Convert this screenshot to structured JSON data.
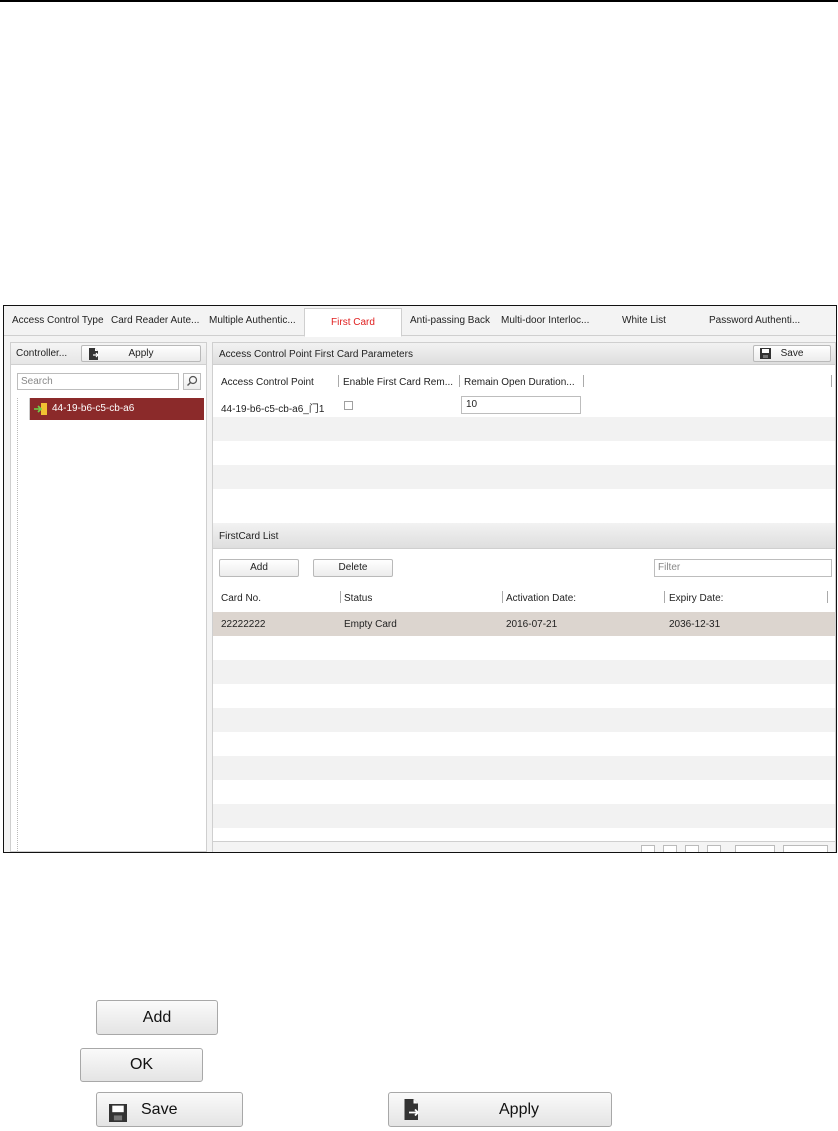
{
  "tabs": [
    {
      "label": "Access Control Type"
    },
    {
      "label": "Card Reader Aute..."
    },
    {
      "label": "Multiple Authentic..."
    },
    {
      "label": "First Card"
    },
    {
      "label": "Anti-passing Back"
    },
    {
      "label": "Multi-door Interloc..."
    },
    {
      "label": "White List"
    },
    {
      "label": "Password Authenti..."
    }
  ],
  "active_tab": "First Card",
  "left_panel": {
    "header_label": "Controller...",
    "apply_label": "Apply",
    "search_placeholder": "Search",
    "tree_item": "44-19-b6-c5-cb-a6"
  },
  "params_section": {
    "title": "Access Control Point First Card Parameters",
    "save_label": "Save",
    "columns": [
      "Access Control Point",
      "Enable First Card Rem...",
      "Remain Open Duration..."
    ],
    "row": {
      "point": "44-19-b6-c5-cb-a6_门1",
      "enabled": false,
      "duration": "10"
    }
  },
  "firstcard_list": {
    "title": "FirstCard List",
    "add_label": "Add",
    "delete_label": "Delete",
    "filter_placeholder": "Filter",
    "columns": [
      "Card No.",
      "Status",
      "Activation Date:",
      "Expiry Date:"
    ],
    "rows": [
      {
        "card_no": "22222222",
        "status": "Empty Card",
        "activation": "2016-07-21",
        "expiry": "2036-12-31"
      }
    ]
  },
  "standalone_buttons": {
    "add": "Add",
    "ok": "OK",
    "save": "Save",
    "apply": "Apply"
  },
  "colors": {
    "active_tab_text": "#e02020",
    "tree_selected": "#8b2a2a",
    "selected_row": "#dcd5cf"
  }
}
